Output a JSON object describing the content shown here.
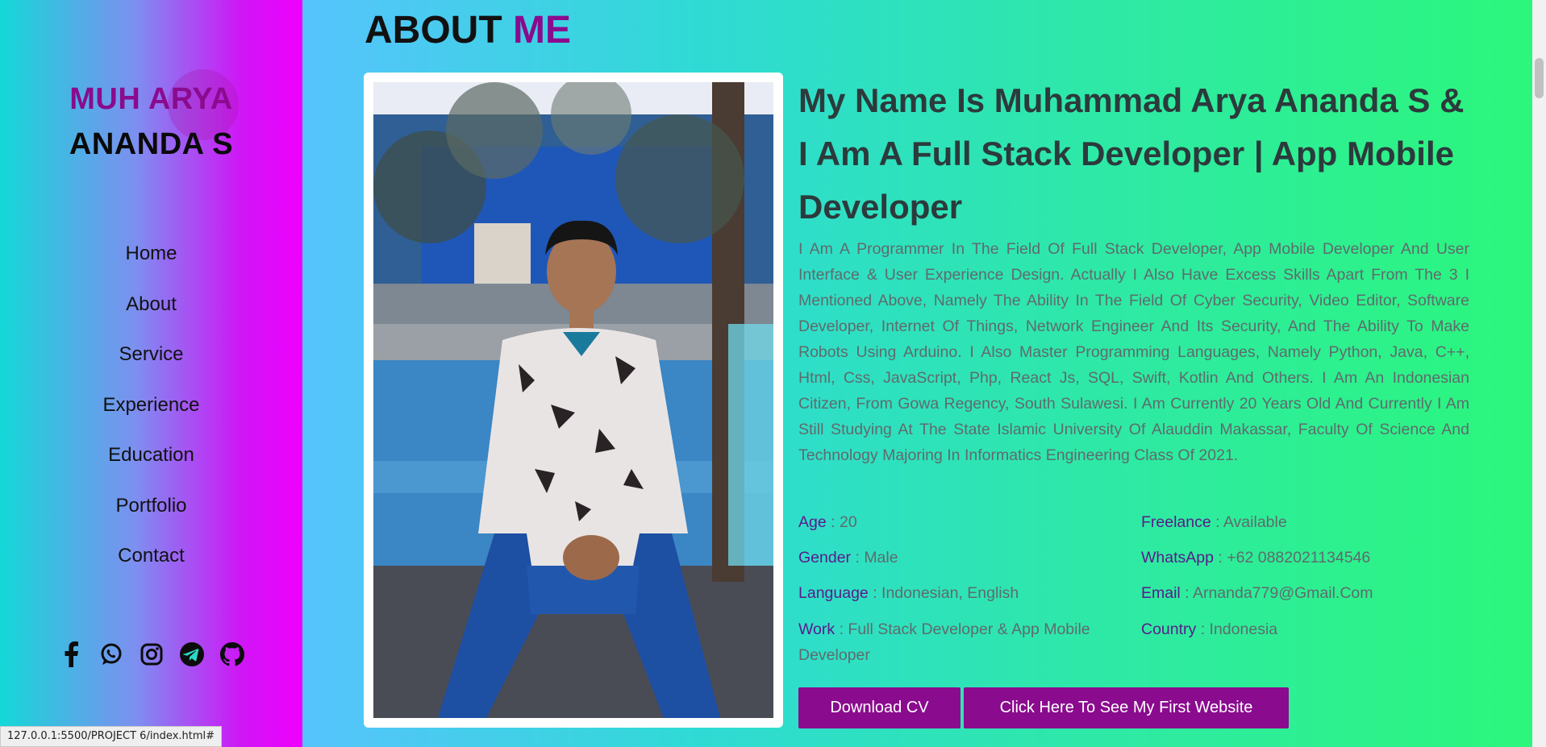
{
  "sidebar": {
    "brand_line1": "MUH ARYA",
    "brand_line2": "ANANDA S",
    "nav": [
      "Home",
      "About",
      "Service",
      "Experience",
      "Education",
      "Portfolio",
      "Contact"
    ],
    "socials": [
      "facebook-icon",
      "whatsapp-icon",
      "instagram-icon",
      "telegram-icon",
      "github-icon"
    ]
  },
  "main": {
    "title_part1": "ABOUT",
    "title_part2": "ME",
    "headline": "My Name Is Muhammad Arya Ananda S & I Am A Full Stack Developer | App Mobile Developer",
    "bio": "I Am A Programmer In The Field Of Full Stack Developer, App Mobile Developer And User Interface & User Experience Design. Actually I Also Have Excess Skills Apart From The 3 I Mentioned Above, Namely The Ability In The Field Of Cyber Security, Video Editor, Software Developer, Internet Of Things, Network Engineer And Its Security, And The Ability To Make Robots Using Arduino. I Also Master Programming Languages, Namely Python, Java, C++, Html, Css, JavaScript, Php, React Js, SQL, Swift, Kotlin And Others. I Am An Indonesian Citizen, From Gowa Regency, South Sulawesi. I Am Currently 20 Years Old And Currently I Am Still Studying At The State Islamic University Of Alauddin Makassar, Faculty Of Science And Technology Majoring In Informatics Engineering Class Of 2021.",
    "info": {
      "age": {
        "label": "Age",
        "value": "20"
      },
      "gender": {
        "label": "Gender",
        "value": "Male"
      },
      "language": {
        "label": "Language",
        "value": "Indonesian, English"
      },
      "work": {
        "label": "Work",
        "value": "Full Stack Developer & App Mobile Developer"
      },
      "freelance": {
        "label": "Freelance",
        "value": "Available"
      },
      "whatsapp": {
        "label": "WhatsApp",
        "value": "+62 0882021134546"
      },
      "email": {
        "label": "Email",
        "value": "Arnanda779@Gmail.Com"
      },
      "country": {
        "label": "Country",
        "value": "Indonesia"
      }
    },
    "buttons": {
      "download_cv": "Download CV",
      "first_website": "Click Here To See My First Website"
    }
  },
  "status_bar": "127.0.0.1:5500/PROJECT 6/index.html#",
  "colors": {
    "accent": "#8a0b8e",
    "sidebar_start": "#14d8d8",
    "sidebar_end": "#f000ff",
    "page_gradient_end": "#2cf77a"
  }
}
